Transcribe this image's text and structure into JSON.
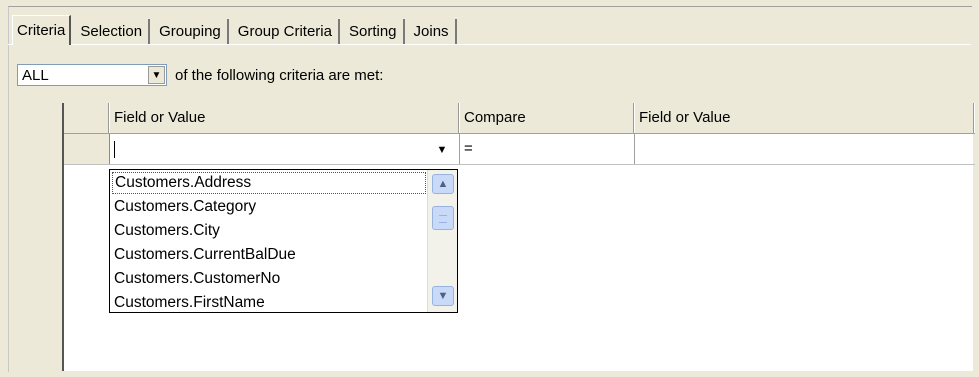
{
  "tabs": [
    {
      "label": "Criteria",
      "active": true
    },
    {
      "label": "Selection",
      "active": false
    },
    {
      "label": "Grouping",
      "active": false
    },
    {
      "label": "Group Criteria",
      "active": false
    },
    {
      "label": "Sorting",
      "active": false
    },
    {
      "label": "Joins",
      "active": false
    }
  ],
  "criteria_mode": {
    "selected": "ALL",
    "suffix_text": "of the following criteria are met:"
  },
  "grid": {
    "headers": [
      "",
      "Field or Value",
      "Compare",
      "Field or Value"
    ],
    "rows": [
      {
        "field1": "",
        "compare": "=",
        "field2": ""
      }
    ]
  },
  "dropdown": {
    "items": [
      "Customers.Address",
      "Customers.Category",
      "Customers.City",
      "Customers.CurrentBalDue",
      "Customers.CustomerNo",
      "Customers.FirstName"
    ],
    "selected_index": 0
  },
  "icons": {
    "dropdown_arrow": "chevron-down-icon",
    "scroll_up": "chevron-up-icon",
    "scroll_down": "chevron-down-icon"
  }
}
